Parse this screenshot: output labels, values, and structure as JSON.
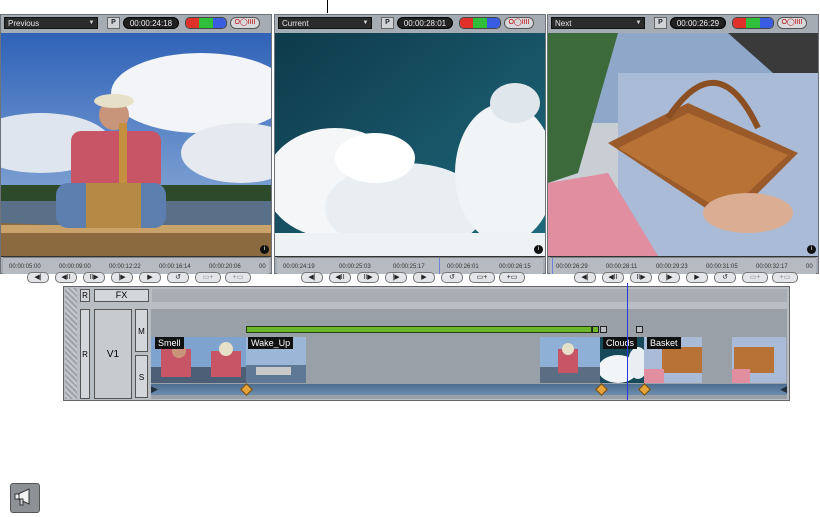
{
  "viewers": [
    {
      "key": "previous",
      "clip_label": "Previous",
      "p_label": "P",
      "timecode": "00:00:24:18",
      "ruler_ticks": [
        "00:00:05:00",
        "00:00:09:00",
        "00:00:12:22",
        "00:00:16:14",
        "00:00:20:06",
        "00"
      ],
      "scene": "fisherman-in-boat"
    },
    {
      "key": "current",
      "clip_label": "Current",
      "p_label": "P",
      "timecode": "00:00:28:01",
      "ruler_ticks": [
        "00:00:24:19",
        "00:00:25:03",
        "00:00:25:17",
        "00:00:26:01",
        "00:00:26:15"
      ],
      "scene": "clouds"
    },
    {
      "key": "next",
      "clip_label": "Next",
      "p_label": "P",
      "timecode": "00:00:26:29",
      "ruler_ticks": [
        "00:00:26:29",
        "00:00:28:11",
        "00:00:29:23",
        "00:00:31:05",
        "00:00:32:17",
        "00"
      ],
      "scene": "picnic-basket"
    }
  ],
  "transport_glyphs": [
    "◀|",
    "◀II",
    "II▶",
    "|▶",
    "▶",
    "↺",
    "▭+",
    "+▭"
  ],
  "monitor_button_label": "O◯IIII",
  "colors": {
    "red": "#e0302a",
    "green": "#2fbf3a",
    "blue": "#3a5ce0",
    "accent_green": "#6ab82a",
    "playhead": "#2838e0",
    "keyframe": "#e8a23a"
  },
  "timeline": {
    "record_label": "R",
    "fx_label": "FX",
    "track_record_label": "R",
    "track_name": "V1",
    "mute_label": "M",
    "solo_label": "S",
    "clips": [
      "Smell",
      "Wake_Up",
      "Clouds",
      "Basket"
    ]
  },
  "tool_icon": "megaphone-icon"
}
